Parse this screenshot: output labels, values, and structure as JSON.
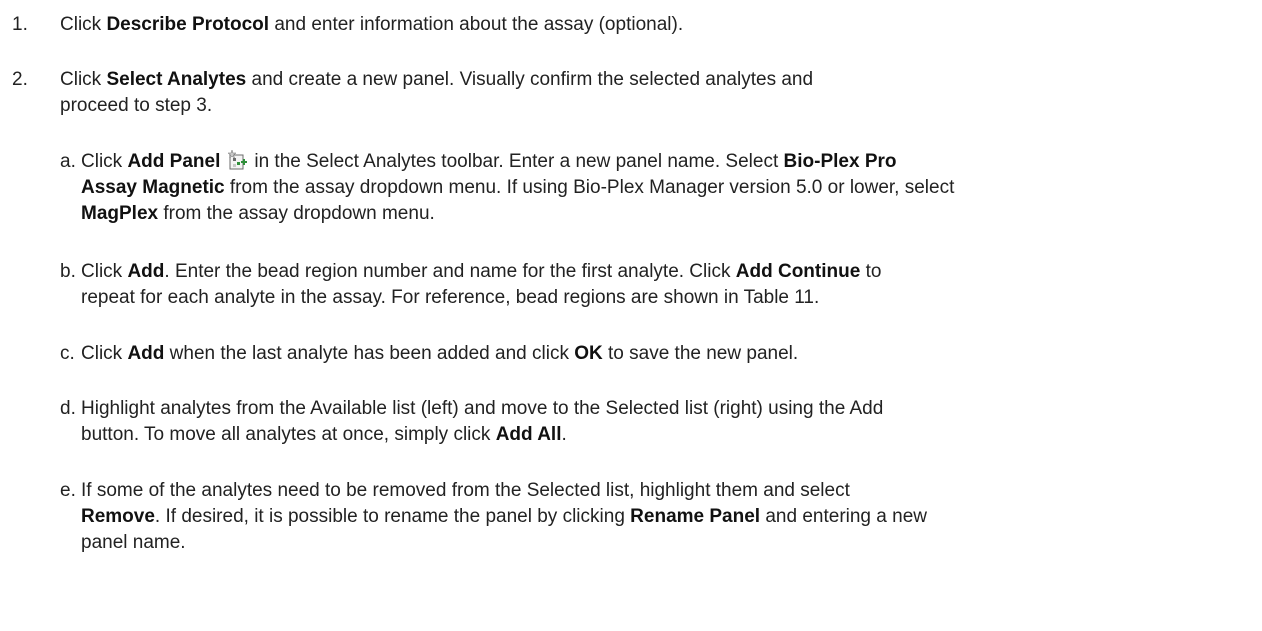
{
  "steps": [
    {
      "number": "1.",
      "segments": [
        {
          "t": "Click "
        },
        {
          "t": "Describe Protocol",
          "b": true
        },
        {
          "t": " and enter information about the assay (optional)."
        }
      ]
    },
    {
      "number": "2.",
      "segments": [
        {
          "t": "Click "
        },
        {
          "t": "Select Analytes",
          "b": true
        },
        {
          "t": " and create a new panel. Visually confirm the selected analytes and"
        },
        {
          "br": true
        },
        {
          "t": "proceed to step 3."
        }
      ]
    }
  ],
  "substeps": [
    {
      "letter": "a.",
      "segments": [
        {
          "t": "Click "
        },
        {
          "t": "Add Panel",
          "b": true
        },
        {
          "icon": "add-panel-icon"
        },
        {
          "t": "in the Select Analytes toolbar. Enter a new panel name. Select "
        },
        {
          "t": "Bio-Plex Pro",
          "b": true
        },
        {
          "br": true
        },
        {
          "t": "Assay Magnetic",
          "b": true
        },
        {
          "t": " from the assay dropdown menu. If using Bio-Plex Manager version 5.0 or lower, select"
        },
        {
          "br": true
        },
        {
          "t": "MagPlex",
          "b": true
        },
        {
          "t": " from the assay dropdown menu."
        }
      ]
    },
    {
      "letter": "b.",
      "segments": [
        {
          "t": "Click "
        },
        {
          "t": "Add",
          "b": true
        },
        {
          "t": ". Enter the bead region number and name for the first analyte. Click "
        },
        {
          "t": "Add Continue",
          "b": true
        },
        {
          "t": " to"
        },
        {
          "br": true
        },
        {
          "t": "repeat for each analyte in the assay. For reference, bead regions are shown in Table 11."
        }
      ]
    },
    {
      "letter": "c.",
      "segments": [
        {
          "t": "Click "
        },
        {
          "t": "Add",
          "b": true
        },
        {
          "t": " when the last analyte has been added and click "
        },
        {
          "t": "OK",
          "b": true
        },
        {
          "t": " to save the new panel."
        }
      ]
    },
    {
      "letter": "d.",
      "segments": [
        {
          "t": "Highlight analytes from the Available list (left) and move to the Selected list (right) using the Add"
        },
        {
          "br": true
        },
        {
          "t": "button. To move all analytes at once, simply click "
        },
        {
          "t": "Add All",
          "b": true
        },
        {
          "t": "."
        }
      ]
    },
    {
      "letter": "e.",
      "segments": [
        {
          "t": "If some of the analytes need to be removed from the Selected list, highlight them and select"
        },
        {
          "br": true
        },
        {
          "t": "Remove",
          "b": true
        },
        {
          "t": ". If desired, it is possible to rename the panel by clicking "
        },
        {
          "t": "Rename Panel",
          "b": true
        },
        {
          "t": " and entering a new"
        },
        {
          "br": true
        },
        {
          "t": "panel name."
        }
      ]
    }
  ],
  "icons": {
    "add-panel-icon": {
      "colors": [
        "#6b6b6b",
        "#2f8f3a",
        "#c8c8c8"
      ]
    }
  }
}
